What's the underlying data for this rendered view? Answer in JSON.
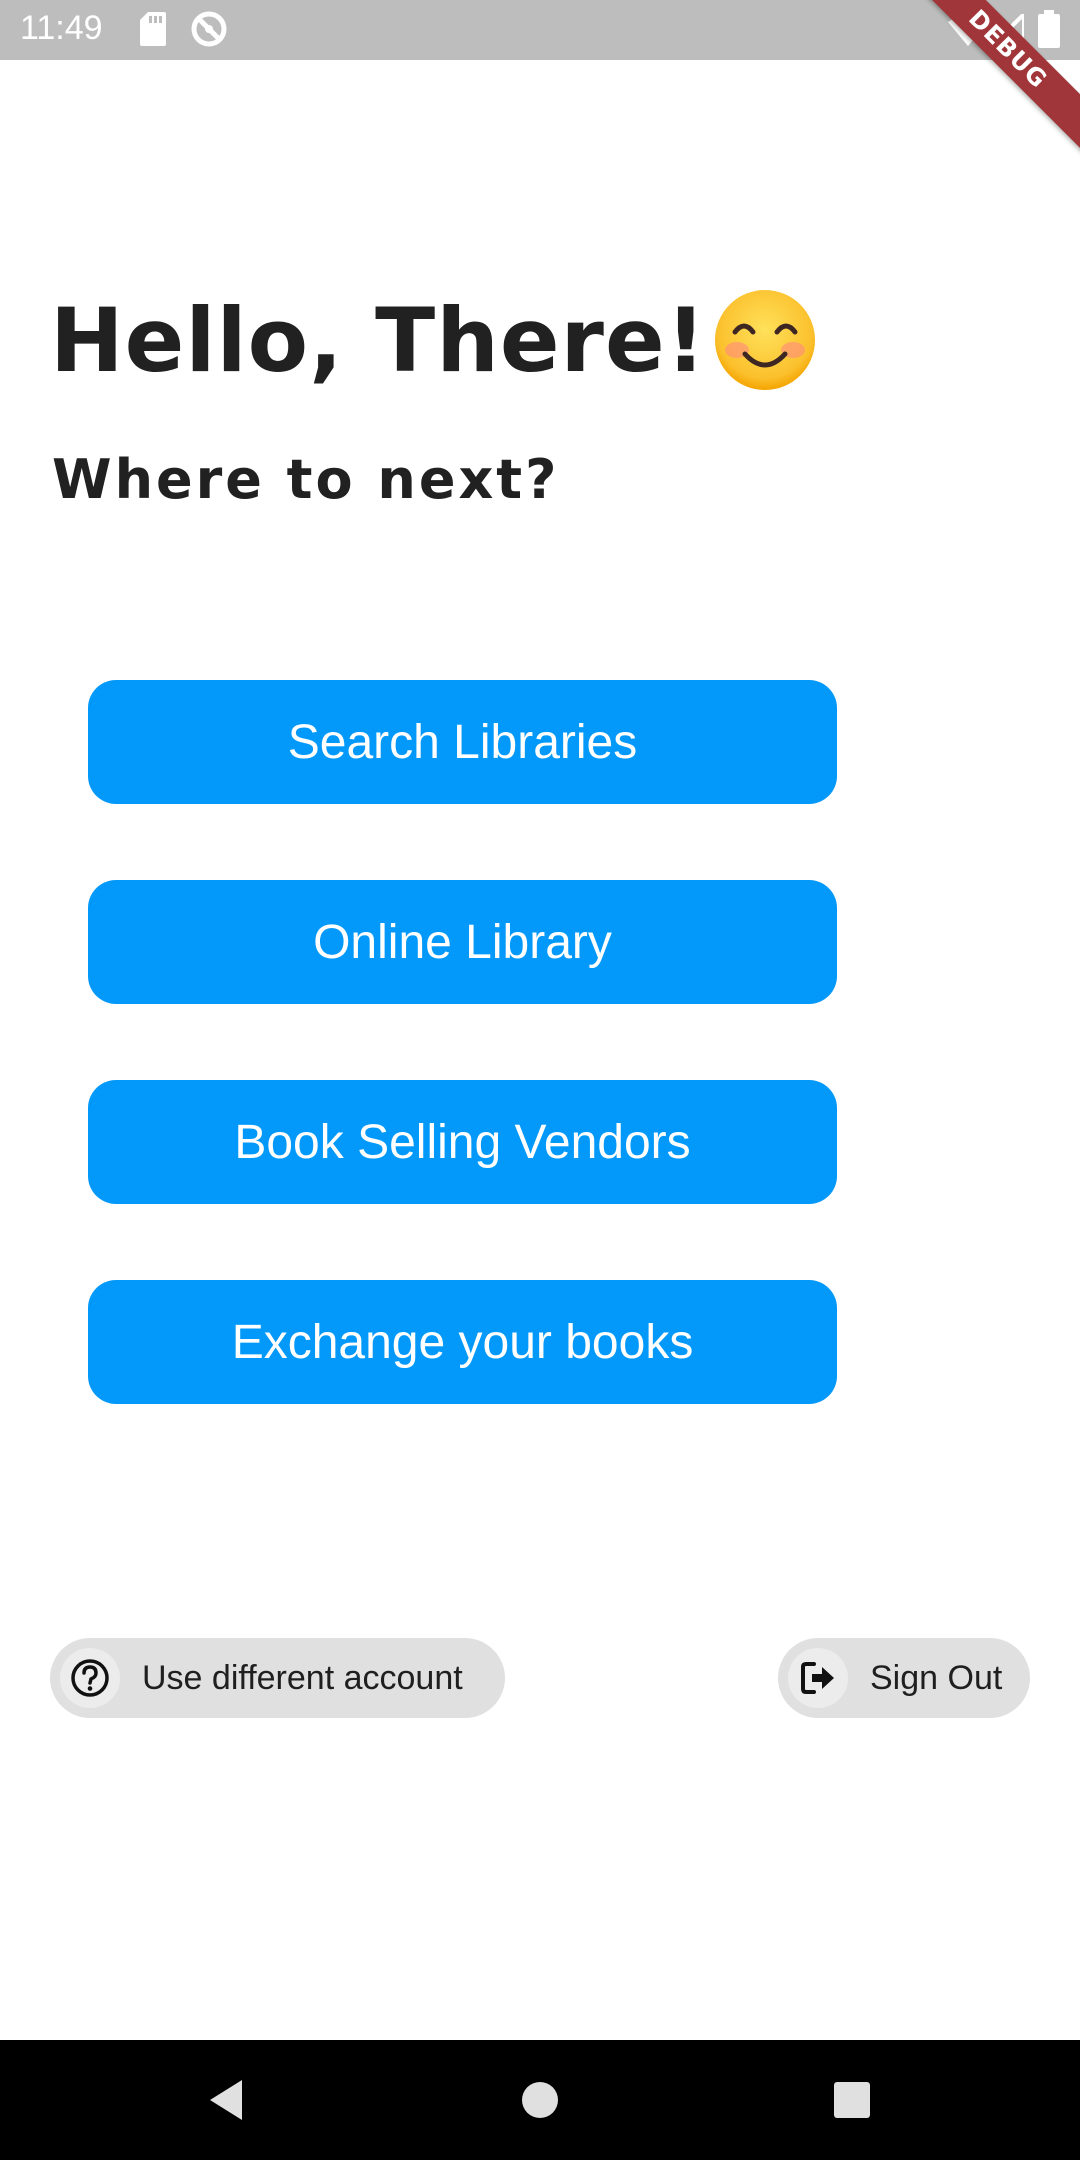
{
  "status_bar": {
    "time": "11:49",
    "icons": [
      "sd-card-icon",
      "no-sync-icon",
      "wifi-icon",
      "signal-icon",
      "battery-icon"
    ]
  },
  "debug_banner": {
    "label": "DEBUG",
    "color": "#a0363a"
  },
  "header": {
    "title": "Hello, There!",
    "emoji": "smiling-face-icon",
    "subtitle": "Where to next?"
  },
  "menu": {
    "accent_color": "#0399fa",
    "buttons": [
      {
        "label": "Search Libraries"
      },
      {
        "label": "Online Library"
      },
      {
        "label": "Book Selling Vendors"
      },
      {
        "label": "Exchange your books"
      }
    ]
  },
  "chips": {
    "different_account": {
      "label": "Use different account",
      "icon": "help-circle-icon"
    },
    "sign_out": {
      "label": "Sign Out",
      "icon": "sign-out-icon"
    }
  },
  "nav_bar": {
    "buttons": [
      "back-icon",
      "home-icon",
      "recents-icon"
    ]
  }
}
